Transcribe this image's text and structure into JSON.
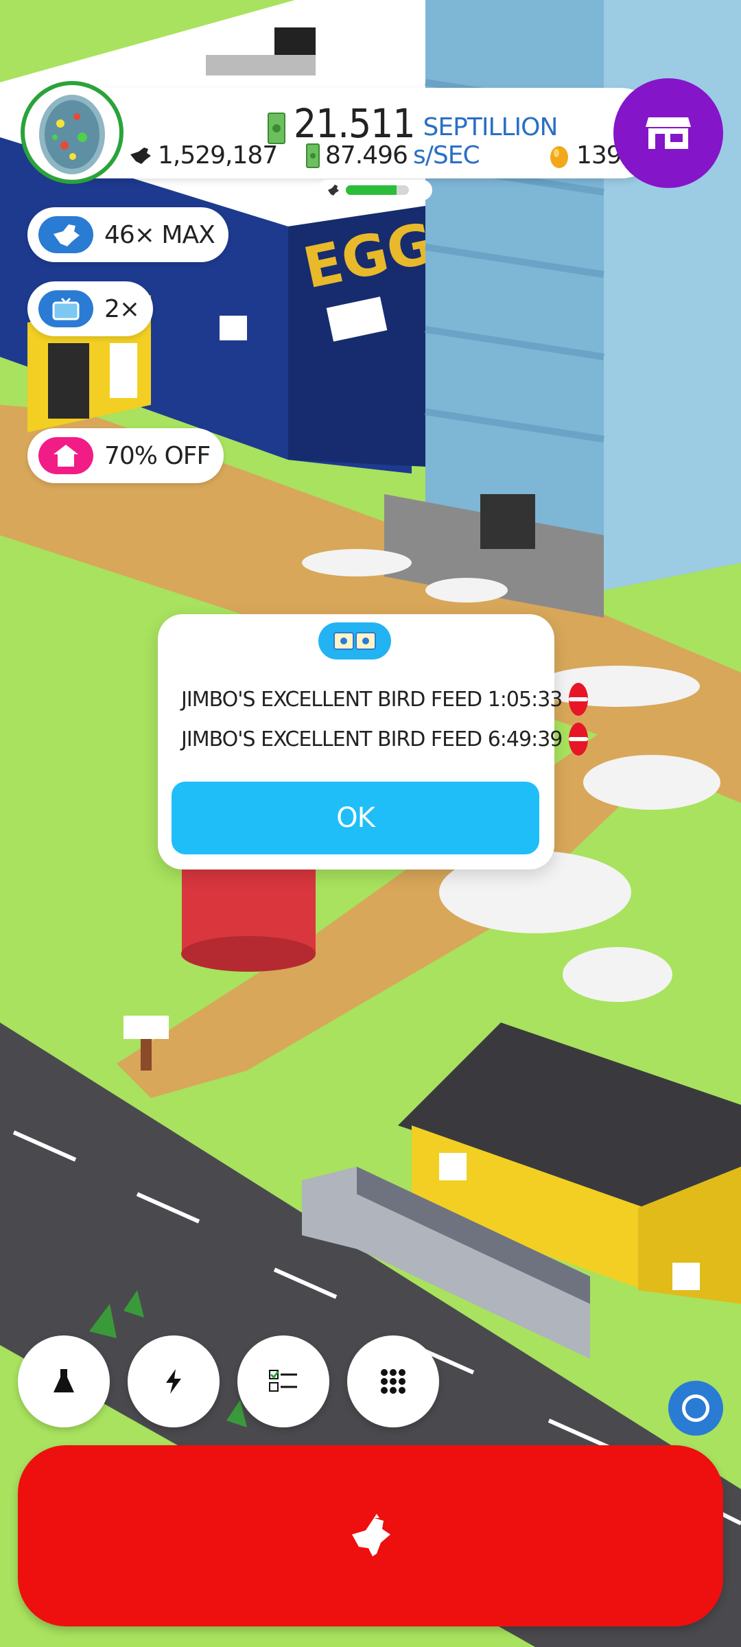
{
  "hud": {
    "money_value": "21.511",
    "money_unit": "SEPTILLION",
    "chicken_count": "1,529,187",
    "earning_rate": "87.496",
    "earning_rate_unit": "s/SEC",
    "golden_eggs": "139",
    "hab_progress": 0.8
  },
  "boosts": {
    "chicken_multiplier": "46× MAX",
    "video_multiplier": "2×",
    "discount": "70% OFF"
  },
  "dialog": {
    "items": [
      {
        "label": "JIMBO'S EXCELLENT BIRD FEED",
        "time": "1:05:33"
      },
      {
        "label": "JIMBO'S EXCELLENT BIRD FEED",
        "time": "6:49:39"
      }
    ],
    "ok_label": "OK"
  },
  "colors": {
    "shop": "#8515c8",
    "hatch": "#ee0f0f",
    "ok": "#1fbef8",
    "grass": "#a8e25e"
  },
  "icons": {
    "bottom": [
      "flask-icon",
      "lightning-icon",
      "checklist-icon",
      "grid-icon"
    ]
  }
}
